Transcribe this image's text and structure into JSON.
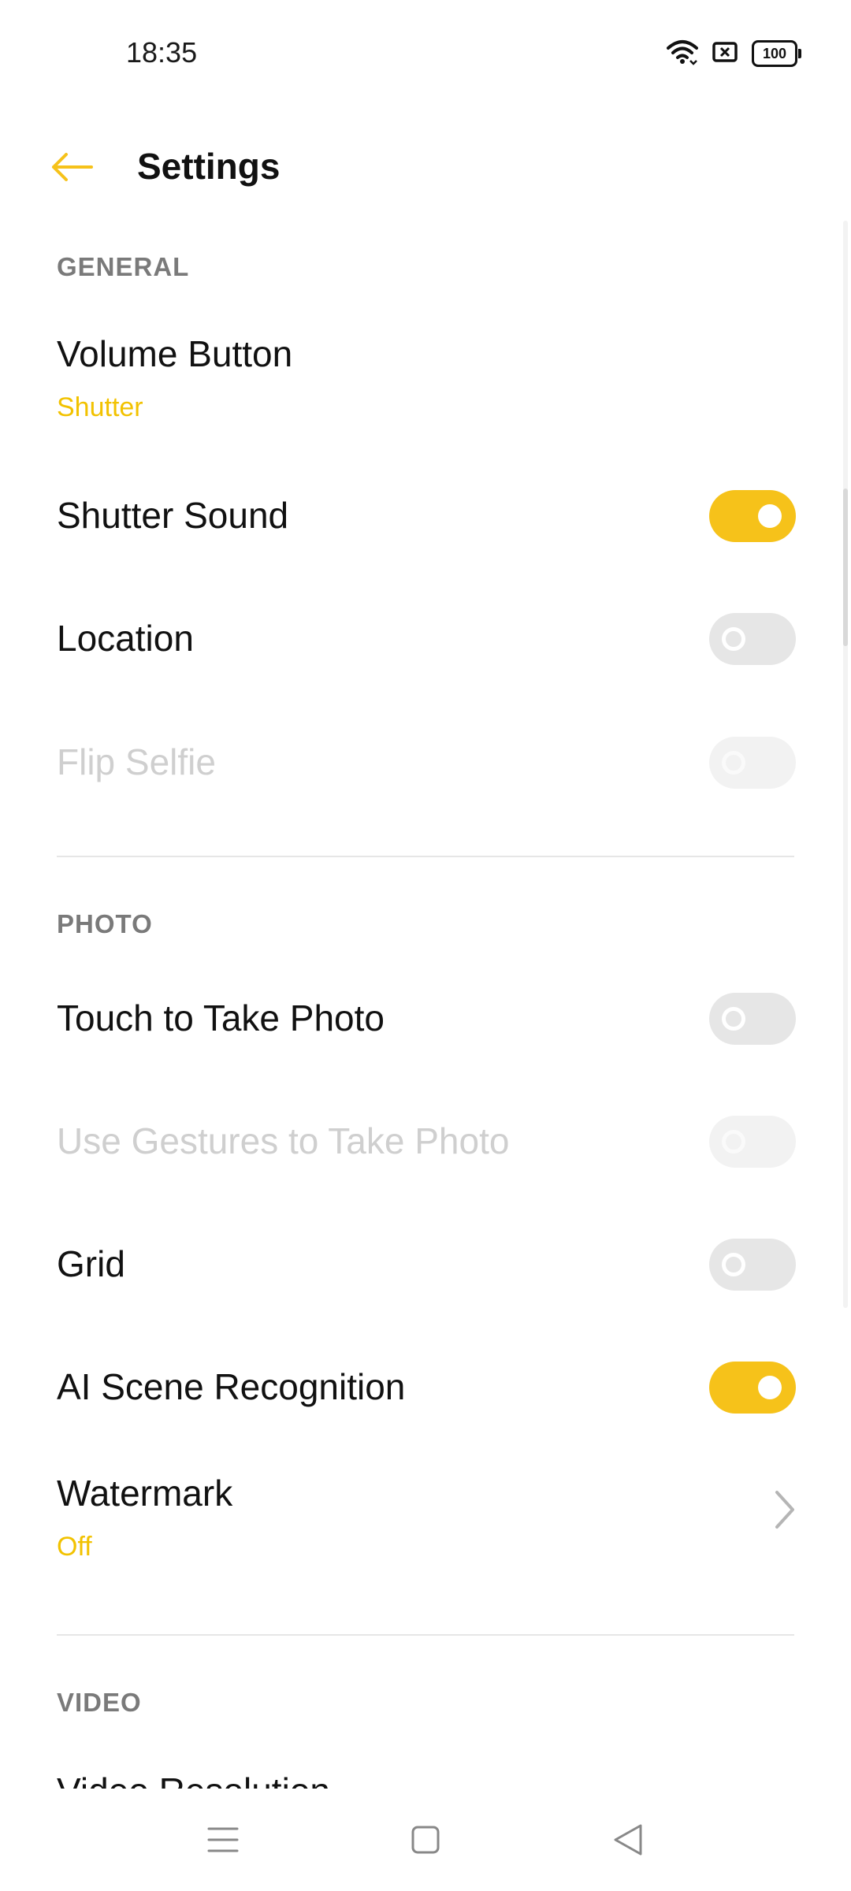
{
  "status_bar": {
    "time": "18:35",
    "battery_level": "100",
    "icons": [
      "wifi-icon",
      "sim-error-icon",
      "battery-icon"
    ]
  },
  "header": {
    "title": "Settings",
    "back_icon": "arrow-left-icon",
    "accent_color": "#f6c21a"
  },
  "sections": {
    "general": {
      "label": "GENERAL",
      "volume_button": {
        "title": "Volume Button",
        "value": "Shutter"
      },
      "shutter_sound": {
        "title": "Shutter Sound",
        "enabled": true
      },
      "location": {
        "title": "Location",
        "enabled": false
      },
      "flip_selfie": {
        "title": "Flip Selfie",
        "enabled": false,
        "disabled": true
      }
    },
    "photo": {
      "label": "PHOTO",
      "touch_to_take_photo": {
        "title": "Touch to Take Photo",
        "enabled": false
      },
      "use_gestures": {
        "title": "Use Gestures to Take Photo",
        "enabled": false,
        "disabled": true
      },
      "grid": {
        "title": "Grid",
        "enabled": false
      },
      "ai_scene": {
        "title": "AI Scene Recognition",
        "enabled": true
      },
      "watermark": {
        "title": "Watermark",
        "value": "Off"
      }
    },
    "video": {
      "label": "VIDEO",
      "video_resolution": {
        "title": "Video Resolution"
      }
    }
  },
  "nav_bar": {
    "icons": [
      "menu-icon",
      "home-square-icon",
      "back-triangle-icon"
    ]
  }
}
